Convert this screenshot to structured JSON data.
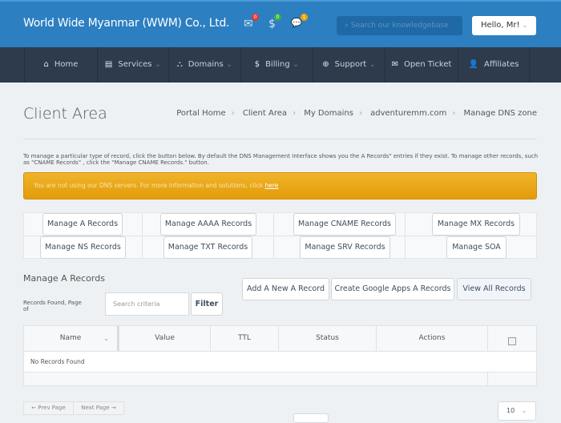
{
  "header": {
    "brand": "World Wide Myanmar (WWM) Co., Ltd.",
    "icons": [
      {
        "name": "envelope-icon",
        "glyph": "✉",
        "count": "0",
        "color": "#e53935"
      },
      {
        "name": "dollar-icon",
        "glyph": "$",
        "count": "0",
        "color": "#3cb043"
      },
      {
        "name": "chat-icon",
        "glyph": "💬",
        "count": "1",
        "color": "#f0a500"
      }
    ],
    "search_placeholder": "Search our knowledgebase",
    "user": "Hello, Mr!"
  },
  "nav": [
    {
      "label": "Home",
      "icon": "⌂"
    },
    {
      "label": "Services",
      "icon": "▤"
    },
    {
      "label": "Domains",
      "icon": "⛬"
    },
    {
      "label": "Billing",
      "icon": "$"
    },
    {
      "label": "Support",
      "icon": "⊕"
    },
    {
      "label": "Open Ticket",
      "icon": "✉"
    },
    {
      "label": "Affiliates",
      "icon": "👤"
    }
  ],
  "page": {
    "title": "Client Area",
    "breadcrumb": [
      "Portal Home",
      "Client Area",
      "My Domains",
      "adventuremm.com",
      "Manage DNS zone"
    ],
    "description": "To manage a particular type of record, click the button below. By default the DNS Management Interface shows you the  A Records\" entries if they exist. To manage other records, such as \"CNAME Records\" , click the \"Manage CNAME Records.\" button.",
    "alert_text": "You are not using our DNS servers. For more information and solutions, click ",
    "alert_link": "here"
  },
  "record_buttons": [
    "Manage A Records",
    "Manage AAAA Records",
    "Manage CNAME Records",
    "Manage MX Records",
    "Manage NS Records",
    "Manage TXT Records",
    "Manage SRV Records",
    "Manage SOA"
  ],
  "records": {
    "heading": "Manage A Records",
    "found_text": "Records Found, Page of",
    "search_placeholder": "Search criteria",
    "filter": "Filter",
    "add": "Add A New A Record",
    "google": "Create Google Apps A Records",
    "view_all": "View All Records",
    "columns": [
      "Name",
      "Value",
      "TTL",
      "Status",
      "Actions"
    ],
    "empty": "No Records Found",
    "prev": "← Prev Page",
    "next": "Next Page →",
    "per_page": "10"
  }
}
